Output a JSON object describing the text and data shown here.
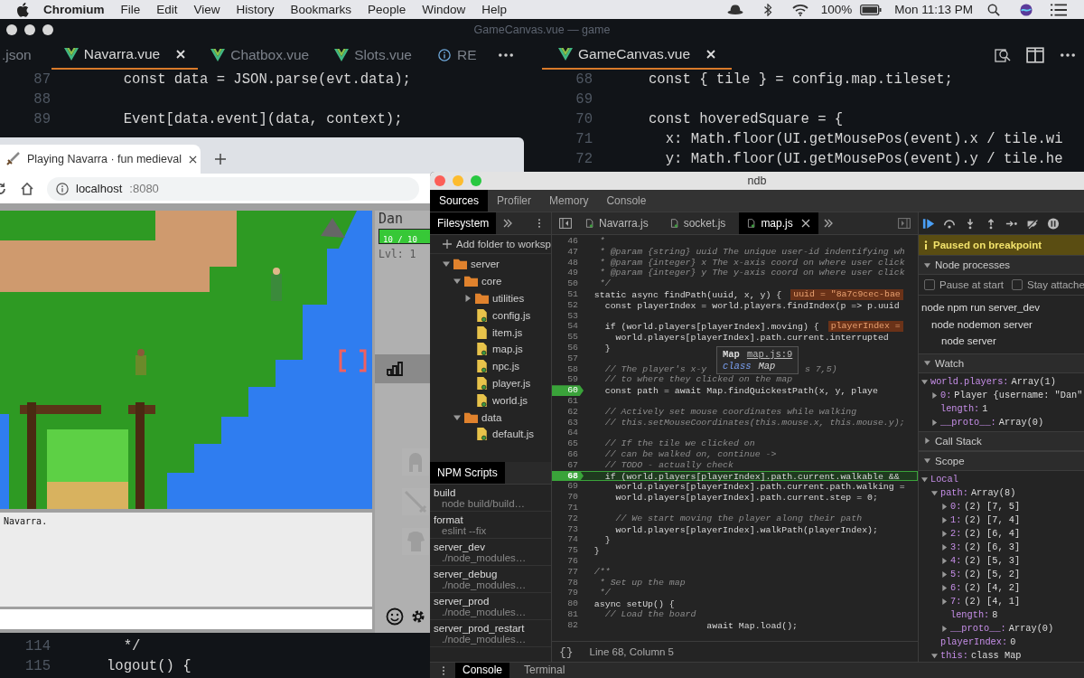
{
  "menubar": {
    "app": "Chromium",
    "menus": [
      "File",
      "Edit",
      "View",
      "History",
      "Bookmarks",
      "People",
      "Window",
      "Help"
    ],
    "battery": "100%",
    "clock": "Mon 11:13 PM"
  },
  "editor": {
    "title": "GameCanvas.vue — game",
    "left_tabs": [
      {
        "label": ".json",
        "selected": false,
        "kind": "plain"
      },
      {
        "label": "Navarra.vue",
        "selected": true,
        "kind": "vue"
      },
      {
        "label": "Chatbox.vue",
        "selected": false,
        "kind": "vue"
      },
      {
        "label": "Slots.vue",
        "selected": false,
        "kind": "vue"
      },
      {
        "label": "RE",
        "selected": false,
        "kind": "info"
      }
    ],
    "right_tabs": [
      {
        "label": "GameCanvas.vue",
        "selected": true,
        "kind": "vue"
      }
    ],
    "left_top_lines": [
      {
        "n": "87",
        "text": "  const data = JSON.parse(evt.data);"
      },
      {
        "n": "88"
      },
      {
        "n": "89",
        "text": "  Event[data.event](data, context);"
      }
    ],
    "left_bottom_lines": [
      {
        "n": "114",
        "text": "  */"
      },
      {
        "n": "115",
        "text": "logout() {"
      }
    ],
    "right_lines": [
      {
        "n": "68",
        "text": "const { tile } = config.map.tileset;"
      },
      {
        "n": "69"
      },
      {
        "n": "70",
        "text": "const hoveredSquare = {"
      },
      {
        "n": "71",
        "text": "  x: Math.floor(UI.getMousePos(event).x / tile.wi"
      },
      {
        "n": "72",
        "text": "  y: Math.floor(UI.getMousePos(event).y / tile.he"
      }
    ]
  },
  "browser": {
    "tab_title": "Playing Navarra · fun medieval",
    "url_host": "localhost",
    "url_port": ":8080",
    "game": {
      "player_name": "Dan",
      "hp": {
        "text": "10 / 10",
        "level": 1
      },
      "player_level": "Lvl: 1",
      "chat": [
        "Navarra."
      ]
    }
  },
  "ndb": {
    "title": "ndb",
    "tabs": [
      {
        "label": "Sources",
        "selected": true
      },
      {
        "label": "Profiler",
        "selected": false
      },
      {
        "label": "Memory",
        "selected": false
      },
      {
        "label": "Console",
        "selected": false
      }
    ],
    "navigator_tab": "Filesystem",
    "add_folder": "Add folder to worksp",
    "tree": [
      {
        "name": "server",
        "kind": "folder",
        "expanded": true,
        "children": [
          {
            "name": "core",
            "kind": "folder",
            "expanded": true,
            "children": [
              {
                "name": "utilities",
                "kind": "folder",
                "expanded": false
              },
              {
                "name": "config.js",
                "kind": "file",
                "mapped": true
              },
              {
                "name": "item.js",
                "kind": "file",
                "mapped": false
              },
              {
                "name": "map.js",
                "kind": "file",
                "mapped": true
              },
              {
                "name": "npc.js",
                "kind": "file",
                "mapped": true
              },
              {
                "name": "player.js",
                "kind": "file",
                "mapped": true
              },
              {
                "name": "world.js",
                "kind": "file",
                "mapped": true
              }
            ]
          },
          {
            "name": "data",
            "kind": "folder",
            "expanded": true,
            "children": [
              {
                "name": "default.js",
                "kind": "file",
                "mapped": true
              }
            ]
          }
        ]
      }
    ],
    "npm_tab": "NPM Scripts",
    "scripts": [
      {
        "name": "build",
        "command": "node build/build…"
      },
      {
        "name": "format",
        "command": "eslint --fix"
      },
      {
        "name": "server_dev",
        "command": "./node_modules…"
      },
      {
        "name": "server_debug",
        "command": "./node_modules…"
      },
      {
        "name": "server_prod",
        "command": "./node_modules…"
      },
      {
        "name": "server_prod_restart",
        "command": "./node_modules…"
      }
    ],
    "source_tabs": [
      {
        "label": "Navarra.js",
        "selected": false
      },
      {
        "label": "socket.js",
        "selected": false
      },
      {
        "label": "map.js",
        "selected": true
      }
    ],
    "code": [
      {
        "n": "46",
        "text": "   *",
        "kind": "comment",
        "breakpoint": false,
        "current": false
      },
      {
        "n": "47",
        "text": "   * @param {string} uuid The unique user-id indentifying wh",
        "kind": "comment",
        "breakpoint": false,
        "current": false
      },
      {
        "n": "48",
        "text": "   * @param {integer} x The x-axis coord on where user click",
        "kind": "comment",
        "breakpoint": false,
        "current": false
      },
      {
        "n": "49",
        "text": "   * @param {integer} y The y-axis coord on where user click",
        "kind": "comment",
        "breakpoint": false,
        "current": false
      },
      {
        "n": "50",
        "text": "   */",
        "kind": "comment",
        "breakpoint": false,
        "current": false
      },
      {
        "n": "51",
        "text": "  static async findPath(uuid, x, y) {",
        "kind": "code",
        "breakpoint": false,
        "current": false,
        "inline": "uuid = \"8a7c9cec-bae"
      },
      {
        "n": "52",
        "text": "    const playerIndex = world.players.findIndex(p => p.uuid",
        "kind": "code",
        "breakpoint": false,
        "current": false
      },
      {
        "n": "53",
        "breakpoint": false,
        "current": false
      },
      {
        "n": "54",
        "text": "    if (world.players[playerIndex].moving) {",
        "kind": "code",
        "breakpoint": false,
        "current": false,
        "inline": "playerIndex ="
      },
      {
        "n": "55",
        "text": "      world.players[playerIndex].path.current.interrupted",
        "kind": "code",
        "breakpoint": false,
        "current": false
      },
      {
        "n": "56",
        "text": "    }",
        "kind": "code",
        "breakpoint": false,
        "current": false
      },
      {
        "n": "57",
        "breakpoint": false,
        "current": false
      },
      {
        "n": "58",
        "text": "    // The player's x-y",
        "kind": "comment",
        "breakpoint": false,
        "current": false,
        "tail": "s 7,5)"
      },
      {
        "n": "59",
        "text": "    // to where they clicked on the map",
        "kind": "comment",
        "breakpoint": false,
        "current": false
      },
      {
        "n": "60",
        "text": "    const path = await Map.findQuickestPath(x, y, playe",
        "kind": "code",
        "breakpoint": true,
        "current": false
      },
      {
        "n": "61",
        "breakpoint": false,
        "current": false
      },
      {
        "n": "62",
        "text": "    // Actively set mouse coordinates while walking",
        "kind": "comment",
        "breakpoint": false,
        "current": false
      },
      {
        "n": "63",
        "text": "    // this.setMouseCoordinates(this.mouse.x, this.mouse.y);",
        "kind": "comment",
        "breakpoint": false,
        "current": false
      },
      {
        "n": "64",
        "breakpoint": false,
        "current": false
      },
      {
        "n": "65",
        "text": "    // If the tile we clicked on",
        "kind": "comment",
        "breakpoint": false,
        "current": false
      },
      {
        "n": "66",
        "text": "    // can be walked on, continue ->",
        "kind": "comment",
        "breakpoint": false,
        "current": false
      },
      {
        "n": "67",
        "text": "    // TODO - actually check",
        "kind": "comment",
        "breakpoint": false,
        "current": false
      },
      {
        "n": "68",
        "text": "    if (world.players[playerIndex].path.current.walkable &&",
        "kind": "code",
        "breakpoint": true,
        "current": true
      },
      {
        "n": "69",
        "text": "      world.players[playerIndex].path.current.path.walking =",
        "kind": "code",
        "breakpoint": false,
        "current": false
      },
      {
        "n": "70",
        "text": "      world.players[playerIndex].path.current.step = 0;",
        "kind": "code",
        "breakpoint": false,
        "current": false
      },
      {
        "n": "71",
        "breakpoint": false,
        "current": false
      },
      {
        "n": "72",
        "text": "      // We start moving the player along their path",
        "kind": "comment",
        "breakpoint": false,
        "current": false
      },
      {
        "n": "73",
        "text": "      world.players[playerIndex].walkPath(playerIndex);",
        "kind": "code",
        "breakpoint": false,
        "current": false
      },
      {
        "n": "74",
        "text": "    }",
        "kind": "code",
        "breakpoint": false,
        "current": false
      },
      {
        "n": "75",
        "text": "  }",
        "kind": "code",
        "breakpoint": false,
        "current": false
      },
      {
        "n": "76",
        "breakpoint": false,
        "current": false
      },
      {
        "n": "77",
        "text": "  /**",
        "kind": "comment",
        "breakpoint": false,
        "current": false
      },
      {
        "n": "78",
        "text": "   * Set up the map",
        "kind": "comment",
        "breakpoint": false,
        "current": false
      },
      {
        "n": "79",
        "text": "   */",
        "kind": "comment",
        "breakpoint": false,
        "current": false
      },
      {
        "n": "80",
        "text": "  async setUp() {",
        "kind": "code",
        "breakpoint": false,
        "current": false
      },
      {
        "n": "81",
        "text": "    // Load the board",
        "kind": "comment",
        "breakpoint": false,
        "current": false
      },
      {
        "n": "82",
        "text": "                       await Map.load();",
        "kind": "code",
        "breakpoint": false,
        "current": false
      }
    ],
    "tooltip": {
      "title": "Map",
      "link": "map.js:9",
      "keyword": "class",
      "name": "Map"
    },
    "format_button": "{}",
    "status": "Line 68, Column 5",
    "banner": "Paused on breakpoint",
    "sections": [
      {
        "kind": "processes",
        "title": "Node processes",
        "expanded": true,
        "checkboxes": [
          {
            "label": "Pause at start",
            "checked": false
          },
          {
            "label": "Stay attache",
            "checked": false
          }
        ],
        "processes": [
          {
            "text": "node npm run server_dev",
            "children": [
              {
                "text": "node nodemon server",
                "children": [
                  {
                    "text": "node server"
                  }
                ]
              }
            ]
          }
        ]
      },
      {
        "kind": "tree",
        "title": "Watch",
        "expanded": true,
        "items": [
          {
            "name": "world.players:",
            "value": "Array(1)",
            "expanded": true,
            "children": [
              {
                "name": "0:",
                "value": "Player {username: \"Dan\"",
                "expanded": false
              },
              {
                "name": "length:",
                "value": "1"
              },
              {
                "name": "__proto__:",
                "value": "Array(0)",
                "expanded": false
              }
            ]
          }
        ]
      },
      {
        "title": "Call Stack",
        "expanded": false
      },
      {
        "kind": "tree",
        "title": "Scope",
        "expanded": true,
        "items": [
          {
            "name": "Local",
            "expanded": true,
            "children": [
              {
                "name": "path:",
                "value": "Array(8)",
                "expanded": true,
                "children": [
                  {
                    "name": "0:",
                    "value": "(2) [7, 5]",
                    "expanded": false
                  },
                  {
                    "name": "1:",
                    "value": "(2) [7, 4]",
                    "expanded": false
                  },
                  {
                    "name": "2:",
                    "value": "(2) [6, 4]",
                    "expanded": false
                  },
                  {
                    "name": "3:",
                    "value": "(2) [6, 3]",
                    "expanded": false
                  },
                  {
                    "name": "4:",
                    "value": "(2) [5, 3]",
                    "expanded": false
                  },
                  {
                    "name": "5:",
                    "value": "(2) [5, 2]",
                    "expanded": false
                  },
                  {
                    "name": "6:",
                    "value": "(2) [4, 2]",
                    "expanded": false
                  },
                  {
                    "name": "7:",
                    "value": "(2) [4, 1]",
                    "expanded": false
                  },
                  {
                    "name": "length:",
                    "value": "8"
                  },
                  {
                    "name": "__proto__:",
                    "value": "Array(0)",
                    "expanded": false
                  }
                ]
              },
              {
                "name": "playerIndex:",
                "value": "0"
              },
              {
                "name": "this:",
                "value": "class Map",
                "expanded": true
              }
            ]
          }
        ]
      }
    ],
    "drawer_tabs": [
      {
        "label": "Console",
        "selected": true
      },
      {
        "label": "Terminal",
        "selected": false
      }
    ]
  }
}
